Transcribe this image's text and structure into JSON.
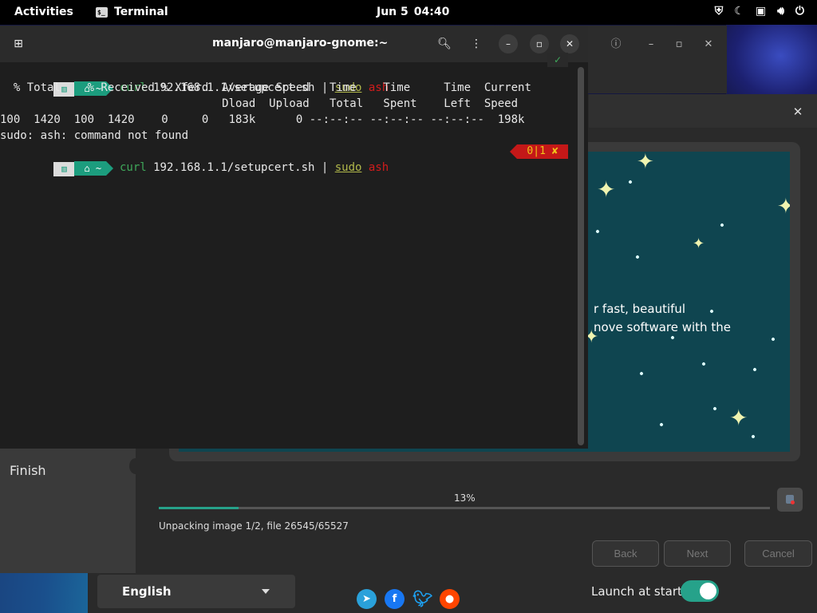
{
  "topbar": {
    "activities": "Activities",
    "app_name": "Terminal",
    "date": "Jun 5",
    "time": "04:40"
  },
  "terminal": {
    "title": "manjaro@manjaro-gnome:~",
    "prompt_dir": "~",
    "lines": {
      "cmd1": "curl 192.168.1.1/setupcert.sh | sudo ash",
      "hdr1": "  % Total    % Received % Xferd  Average Speed   Time    Time     Time  Current",
      "hdr2": "                                 Dload  Upload   Total   Spent    Left  Speed",
      "stats": "100  1420  100  1420    0     0   183k      0 --:--:-- --:--:-- --:--:--  198k",
      "error": "sudo: ash: command not found"
    },
    "cmd_parts": {
      "curl": "curl",
      "url": " 192.168.1.1/setupcert.sh ",
      "pipe": "| ",
      "sudo": "sudo",
      "ash": "ash"
    },
    "ok_status": "✓",
    "err_status": "0|1 ✘"
  },
  "installer": {
    "sidebar_finish": "Finish",
    "slide_text_1": "r fast, beautiful",
    "slide_text_2": "nove software with the",
    "progress_label": "13%",
    "progress_value": 13,
    "status": "Unpacking image 1/2, file 26545/65527",
    "back": "Back",
    "next": "Next",
    "cancel": "Cancel"
  },
  "welcome": {
    "language": "English",
    "launch_label": "Launch at start",
    "launch_on": true
  },
  "colors": {
    "accent": "#26a28a",
    "prompt_green": "#1c9d7e",
    "error_red": "#c41818"
  }
}
